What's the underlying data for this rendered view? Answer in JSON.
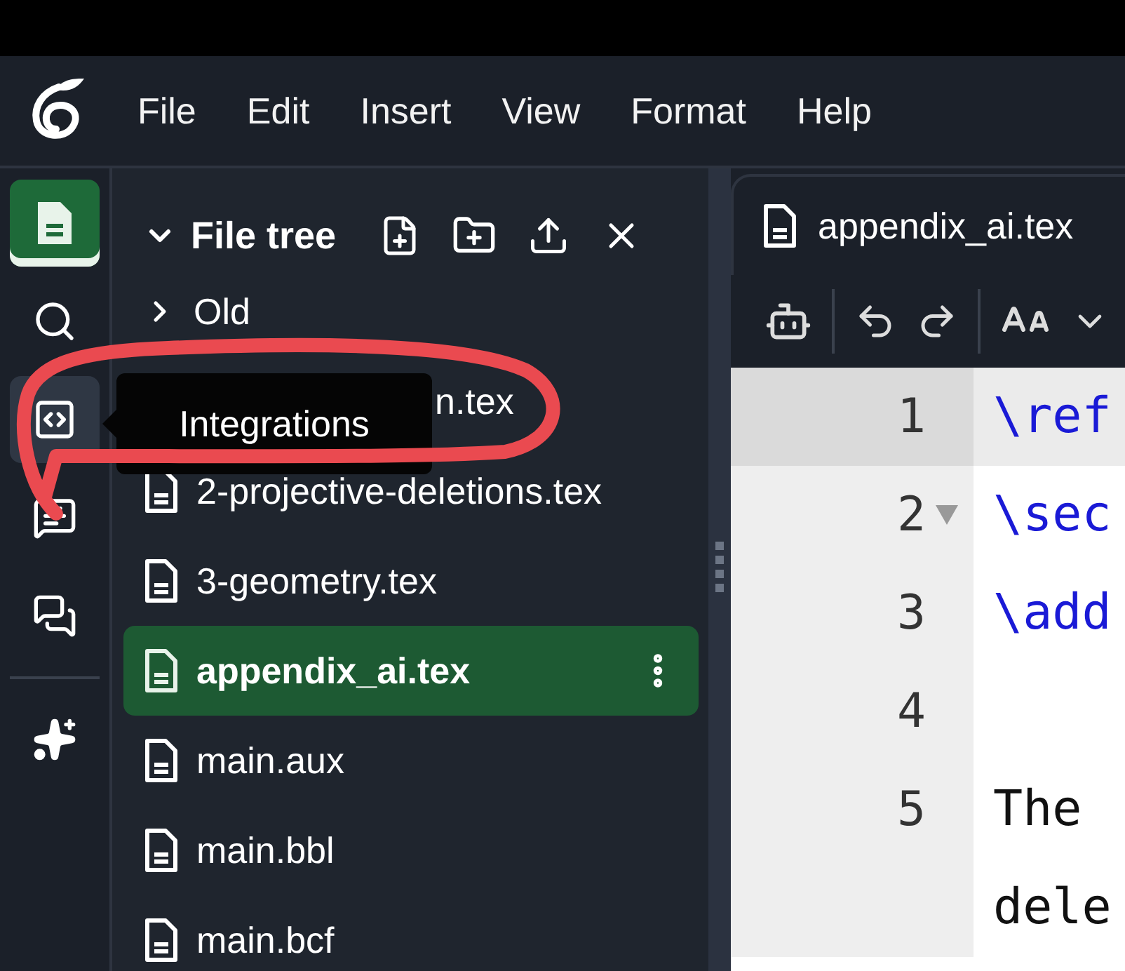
{
  "menu": [
    "File",
    "Edit",
    "Insert",
    "View",
    "Format",
    "Help"
  ],
  "rail": {
    "top": [
      {
        "kind": "files",
        "selected": true,
        "hovered": false
      },
      {
        "kind": "search",
        "selected": false,
        "hovered": false
      },
      {
        "kind": "integrations",
        "selected": false,
        "hovered": true
      },
      {
        "kind": "review",
        "selected": false,
        "hovered": false
      },
      {
        "kind": "chat",
        "selected": false,
        "hovered": false
      }
    ],
    "bottom": [
      {
        "kind": "ai",
        "selected": false,
        "hovered": false
      }
    ]
  },
  "tooltip": "Integrations",
  "file_tree": {
    "title": "File tree",
    "expanded": true,
    "items": [
      {
        "kind": "folder",
        "name": "Old",
        "expanded": false,
        "selected": false
      },
      {
        "kind": "covered",
        "name": "n.tex",
        "selected": false
      },
      {
        "kind": "file",
        "name": "2-projective-deletions.tex",
        "selected": false
      },
      {
        "kind": "file",
        "name": "3-geometry.tex",
        "selected": false
      },
      {
        "kind": "file",
        "name": "appendix_ai.tex",
        "selected": true
      },
      {
        "kind": "file",
        "name": "main.aux",
        "selected": false
      },
      {
        "kind": "file",
        "name": "main.bbl",
        "selected": false
      },
      {
        "kind": "file",
        "name": "main.bcf",
        "selected": false
      }
    ]
  },
  "editor": {
    "tab": "appendix_ai.tex",
    "lines": [
      {
        "number": "1",
        "text": "\\ref",
        "kind": "command",
        "active": true,
        "foldable": false
      },
      {
        "number": "2",
        "text": "\\sec",
        "kind": "command",
        "active": false,
        "foldable": true
      },
      {
        "number": "3",
        "text": "\\add",
        "kind": "command",
        "active": false,
        "foldable": false
      },
      {
        "number": "4",
        "kind": "blank",
        "active": false,
        "foldable": false
      },
      {
        "number": "5",
        "text": "The",
        "kind": "text",
        "active": false,
        "foldable": false,
        "continuation": "dele"
      }
    ]
  }
}
